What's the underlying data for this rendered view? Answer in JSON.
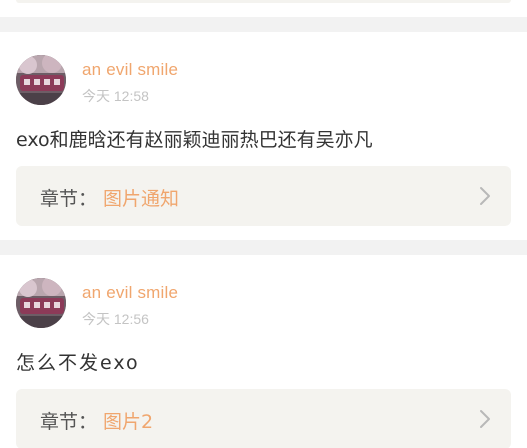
{
  "comments": [
    {
      "username": "an evil smile",
      "time": "今天 12:58",
      "text": "exo和鹿晗还有赵丽颖迪丽热巴还有吴亦凡",
      "chapter_prefix": "章节：",
      "chapter_name": "图片通知"
    },
    {
      "username": "an evil smile",
      "time": "今天 12:56",
      "text": "怎么不发exo",
      "chapter_prefix": "章节：",
      "chapter_name": "图片2"
    }
  ],
  "colors": {
    "accent": "#f0a66e",
    "page_background": "#f2f2f2",
    "chapter_background": "#f4f3ef",
    "timestamp": "#c4c4c4",
    "text": "#333333"
  },
  "icons": {
    "chevron": "chevron-right-icon",
    "avatar": "avatar"
  }
}
